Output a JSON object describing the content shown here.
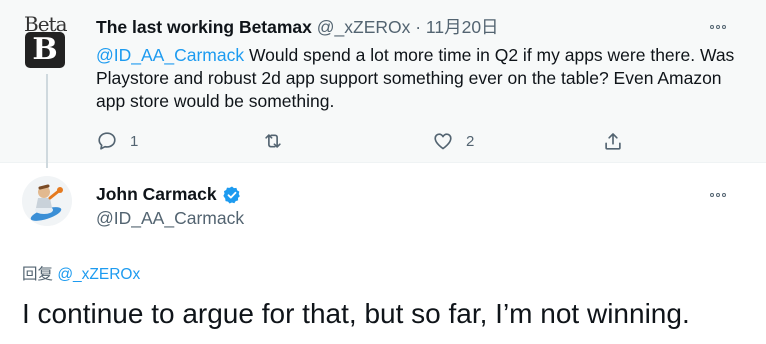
{
  "parent_tweet": {
    "avatar_label": "Beta",
    "avatar_letter": "B",
    "display_name": "The last working Betamax",
    "meta": " @_xZEROx · 11月20日",
    "mention": "@ID_AA_Carmack",
    "text": " Would spend a lot more time in Q2 if my apps were there. Was Playstore and robust 2d app support something ever on the table? Even Amazon app store would be something.",
    "actions": {
      "reply_count": "1",
      "retweet_count": "",
      "like_count": "2"
    }
  },
  "reply_tweet": {
    "display_name": "John Carmack",
    "handle": "@ID_AA_Carmack",
    "reply_prefix": "回复 ",
    "reply_target": "@_xZEROx",
    "text": "I continue to argue for that, but so far, I’m not winning."
  },
  "icons": [
    "more-options-icon",
    "reply-icon",
    "retweet-icon",
    "like-icon",
    "share-icon",
    "verified-badge-icon"
  ],
  "colors": {
    "accent": "#1d9bf0",
    "secondary_text": "#536471",
    "parent_background": "#f7f9f9"
  }
}
